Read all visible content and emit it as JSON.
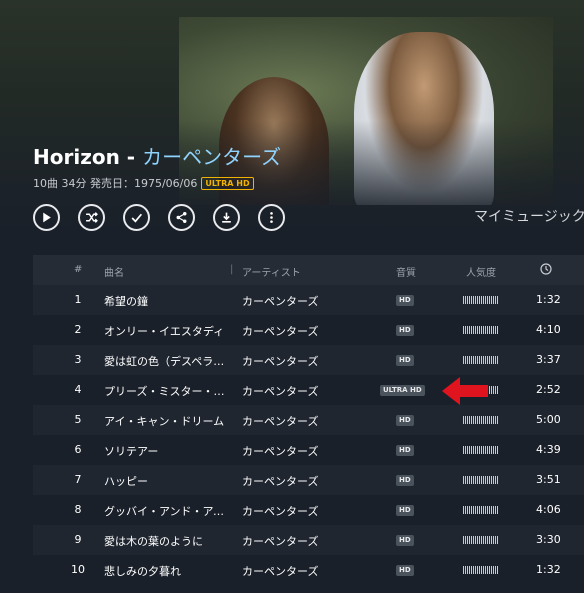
{
  "album": {
    "title": "Horizon",
    "separator": "-",
    "artist": "カーペンターズ",
    "meta": "10曲 34分 発売日：1975/06/06",
    "badge": "ULTRA HD",
    "my_music": "マイミュージック"
  },
  "controls": [
    {
      "name": "play-button",
      "icon": "play-icon"
    },
    {
      "name": "shuffle-button",
      "icon": "shuffle-icon"
    },
    {
      "name": "select-button",
      "icon": "check-icon"
    },
    {
      "name": "share-button",
      "icon": "share-icon"
    },
    {
      "name": "download-button",
      "icon": "download-icon"
    },
    {
      "name": "more-button",
      "icon": "more-icon"
    }
  ],
  "table": {
    "headers": {
      "num": "#",
      "song": "曲名",
      "artist": "アーティスト",
      "quality": "音質",
      "popularity": "人気度",
      "duration_icon": "clock-icon"
    },
    "rows": [
      {
        "num": "1",
        "song": "希望の鐘",
        "artist": "カーペンターズ",
        "quality": "HD",
        "duration": "1:32"
      },
      {
        "num": "2",
        "song": "オンリー・イエスタディ",
        "artist": "カーペンターズ",
        "quality": "HD",
        "duration": "4:10"
      },
      {
        "num": "3",
        "song": "愛は虹の色（デスペラード）",
        "artist": "カーペンターズ",
        "quality": "HD",
        "duration": "3:37"
      },
      {
        "num": "4",
        "song": "プリーズ・ミスター・ポストマン",
        "artist": "カーペンターズ",
        "quality": "ULTRA HD",
        "duration": "2:52"
      },
      {
        "num": "5",
        "song": "アイ・キャン・ドリーム",
        "artist": "カーペンターズ",
        "quality": "HD",
        "duration": "5:00"
      },
      {
        "num": "6",
        "song": "ソリテアー",
        "artist": "カーペンターズ",
        "quality": "HD",
        "duration": "4:39"
      },
      {
        "num": "7",
        "song": "ハッピー",
        "artist": "カーペンターズ",
        "quality": "HD",
        "duration": "3:51"
      },
      {
        "num": "8",
        "song": "グッバイ・アンド・アイ・ラヴ・ユー",
        "artist": "カーペンターズ",
        "quality": "HD",
        "duration": "4:06"
      },
      {
        "num": "9",
        "song": "愛は木の葉のように",
        "artist": "カーペンターズ",
        "quality": "HD",
        "duration": "3:30"
      },
      {
        "num": "10",
        "song": "悲しみの夕暮れ",
        "artist": "カーペンターズ",
        "quality": "HD",
        "duration": "1:32"
      }
    ]
  },
  "annotation": {
    "color": "#e0141e"
  }
}
